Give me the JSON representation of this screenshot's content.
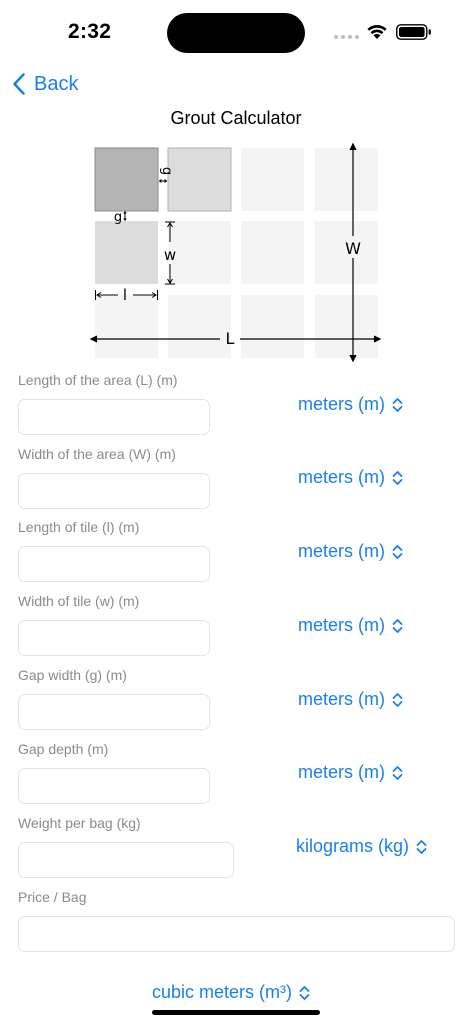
{
  "status": {
    "time": "2:32"
  },
  "nav": {
    "back_label": "Back"
  },
  "page": {
    "title": "Grout Calculator"
  },
  "diagram": {
    "label_g_top": "g",
    "label_g_left": "g",
    "label_w": "w",
    "label_l": "l",
    "label_L": "L",
    "label_W": "W"
  },
  "fields": [
    {
      "label": "Length of the area (L) (m)",
      "value": "",
      "unit": "meters (m)"
    },
    {
      "label": "Width of the area (W) (m)",
      "value": "",
      "unit": "meters (m)"
    },
    {
      "label": "Length of tile (l) (m)",
      "value": "",
      "unit": "meters (m)"
    },
    {
      "label": "Width of tile (w) (m)",
      "value": "",
      "unit": "meters (m)"
    },
    {
      "label": "Gap width (g) (m)",
      "value": "",
      "unit": "meters (m)"
    },
    {
      "label": "Gap depth (m)",
      "value": "",
      "unit": "meters (m)"
    },
    {
      "label": "Weight per bag (kg)",
      "value": "",
      "unit": "kilograms (kg)"
    },
    {
      "label": "Price / Bag",
      "value": ""
    }
  ],
  "result": {
    "unit": "cubic meters (m³)"
  },
  "colors": {
    "accent": "#1a7ff0",
    "label_gray": "#8a8a8e",
    "tile_dark": "#b4b4b4",
    "tile_mid": "#dcdcdc",
    "tile_light": "#f4f4f4"
  }
}
